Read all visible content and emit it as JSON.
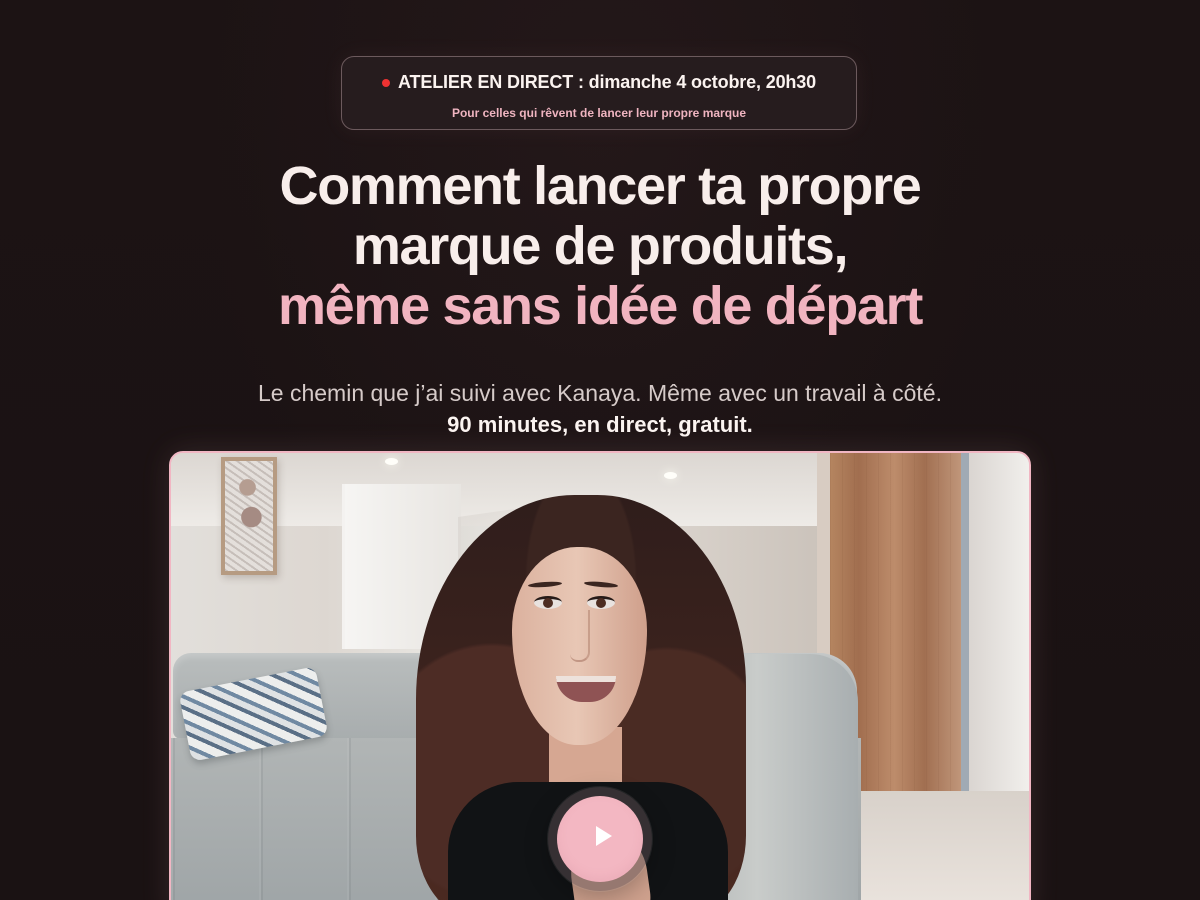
{
  "hero": {
    "live_label": "ATELIER EN DIRECT :",
    "live_date": " dimanche 4 octobre, 20h30",
    "audience": "Pour celles qui rêvent de lancer leur propre marque",
    "title_line_1": "Comment lancer ta propre",
    "title_line_2": "marque de produits,",
    "title_highlight": "même sans idée de départ",
    "description": "Le chemin que j’ai suivi avec Kanaya. Même avec un travail à côté.",
    "details": "90 minutes, en direct, gratuit."
  },
  "video": {
    "play_label": "Lire la vidéo",
    "play_icon": "play-icon"
  },
  "colors": {
    "background": "#1c1314",
    "accent_pink": "#f1b4c0",
    "live_red": "#ee3232",
    "text_light": "#f8eeeb"
  }
}
